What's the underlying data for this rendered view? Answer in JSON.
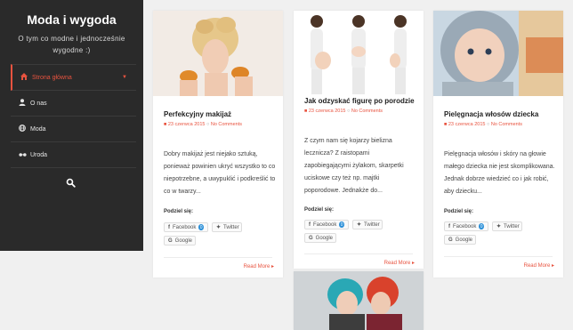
{
  "site": {
    "title": "Moda i wygoda",
    "description": "O tym co modne i jednocześnie wygodne :)"
  },
  "menu": [
    {
      "label": "Strona główna",
      "icon": "home-icon",
      "active": true
    },
    {
      "label": "O nas",
      "icon": "user-icon"
    },
    {
      "label": "Moda",
      "icon": "globe-icon"
    },
    {
      "label": "Uroda",
      "icon": "glasses-icon"
    }
  ],
  "labels": {
    "share": "Podziel się:",
    "read_more": "Read More",
    "no_comments": "No Comments"
  },
  "share_buttons": {
    "facebook": "Facebook",
    "twitter": "Twitter",
    "google": "Google",
    "facebook_count": "0"
  },
  "posts": [
    {
      "title": "Perfekcyjny makijaż",
      "date": "23 czerwca 2015",
      "excerpt": "Dobry makijaż jest niejako sztuką, ponieważ powinien ukryć wszystko to co niepotrzebne, a uwypuklić i podkreślić to co w twarzy..."
    },
    {
      "title": "Jak odzyskać figurę po porodzie",
      "date": "23 czerwca 2015",
      "excerpt": "Z czym nam się kojarzy bielizna lecznicza? Z raistopami zapobiegającymi żylakom, skarpetki uciskowe czy też np. majtki poporodowe. Jednakże do..."
    },
    {
      "title": "Pielęgnacja włosów dziecka",
      "date": "23 czerwca 2015",
      "excerpt": "Pielęgnacja włosów i skóry na głowie małego dziecka nie jest skomplikowana. Jednak dobrze wiedzieć co i jak robić, aby dziecku..."
    }
  ],
  "colors": {
    "accent": "#e8533f",
    "sidebar_bg": "#2a2a2a",
    "page_bg": "#f0f0f0"
  }
}
